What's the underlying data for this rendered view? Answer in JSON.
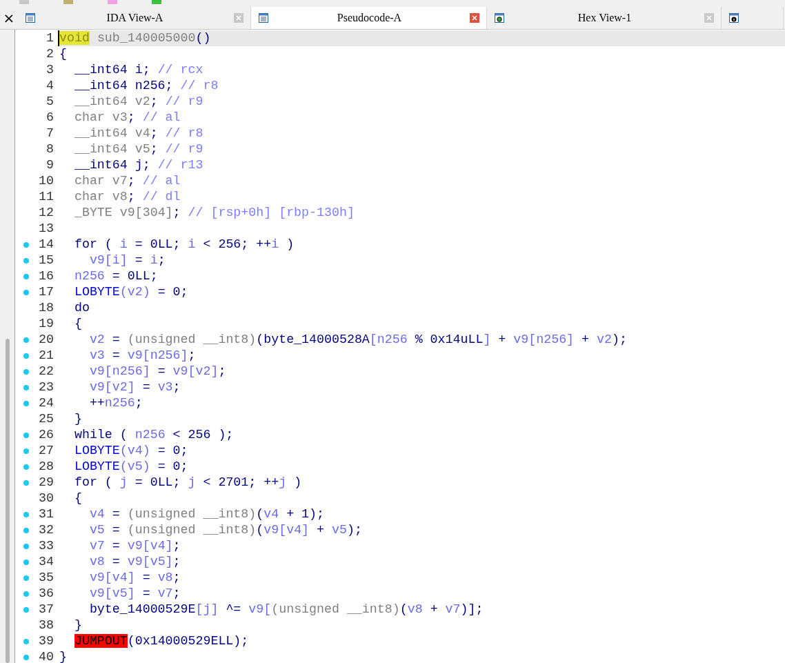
{
  "close_button": {
    "label": "×"
  },
  "tabs": [
    {
      "title": "IDA View-A",
      "kind": "listing",
      "selected": false
    },
    {
      "title": "Pseudocode-A",
      "kind": "listing",
      "selected": true
    },
    {
      "title": "Hex View-1",
      "kind": "hex",
      "selected": false
    },
    {
      "kind": "info",
      "selected": false
    }
  ],
  "code": {
    "lines": [
      {
        "number": "1",
        "breakpoint": false,
        "current": true,
        "tokens": [
          {
            "kind": "highlight",
            "text": "void"
          },
          {
            "kind": "dim",
            "text": " sub_140005000"
          },
          {
            "kind": "plain",
            "text": "()"
          }
        ]
      },
      {
        "number": "2",
        "breakpoint": false,
        "current": false,
        "tokens": [
          {
            "kind": "plain",
            "text": "{"
          }
        ]
      },
      {
        "number": "3",
        "breakpoint": false,
        "current": false,
        "tokens": [
          {
            "kind": "plain",
            "text": "  __int64 i; "
          },
          {
            "kind": "comment",
            "text": "// rcx"
          }
        ]
      },
      {
        "number": "4",
        "breakpoint": false,
        "current": false,
        "tokens": [
          {
            "kind": "plain",
            "text": "  __int64 n256; "
          },
          {
            "kind": "comment",
            "text": "// r8"
          }
        ]
      },
      {
        "number": "5",
        "breakpoint": false,
        "current": false,
        "tokens": [
          {
            "kind": "dim",
            "text": "  __int64 v2"
          },
          {
            "kind": "plain",
            "text": "; "
          },
          {
            "kind": "comment",
            "text": "// r9"
          }
        ]
      },
      {
        "number": "6",
        "breakpoint": false,
        "current": false,
        "tokens": [
          {
            "kind": "dim",
            "text": "  char v3"
          },
          {
            "kind": "plain",
            "text": "; "
          },
          {
            "kind": "comment",
            "text": "// al"
          }
        ]
      },
      {
        "number": "7",
        "breakpoint": false,
        "current": false,
        "tokens": [
          {
            "kind": "dim",
            "text": "  __int64 v4"
          },
          {
            "kind": "plain",
            "text": "; "
          },
          {
            "kind": "comment",
            "text": "// r8"
          }
        ]
      },
      {
        "number": "8",
        "breakpoint": false,
        "current": false,
        "tokens": [
          {
            "kind": "dim",
            "text": "  __int64 v5"
          },
          {
            "kind": "plain",
            "text": "; "
          },
          {
            "kind": "comment",
            "text": "// r9"
          }
        ]
      },
      {
        "number": "9",
        "breakpoint": false,
        "current": false,
        "tokens": [
          {
            "kind": "plain",
            "text": "  __int64 j; "
          },
          {
            "kind": "comment",
            "text": "// r13"
          }
        ]
      },
      {
        "number": "10",
        "breakpoint": false,
        "current": false,
        "tokens": [
          {
            "kind": "dim",
            "text": "  char v7"
          },
          {
            "kind": "plain",
            "text": "; "
          },
          {
            "kind": "comment",
            "text": "// al"
          }
        ]
      },
      {
        "number": "11",
        "breakpoint": false,
        "current": false,
        "tokens": [
          {
            "kind": "dim",
            "text": "  char v8"
          },
          {
            "kind": "plain",
            "text": "; "
          },
          {
            "kind": "comment",
            "text": "// dl"
          }
        ]
      },
      {
        "number": "12",
        "breakpoint": false,
        "current": false,
        "tokens": [
          {
            "kind": "dim",
            "text": "  _BYTE v9[304]"
          },
          {
            "kind": "plain",
            "text": "; "
          },
          {
            "kind": "comment",
            "text": "// [rsp+0h] [rbp-130h]"
          }
        ]
      },
      {
        "number": "13",
        "breakpoint": false,
        "current": false
      },
      {
        "number": "14",
        "breakpoint": true,
        "current": false,
        "tokens": [
          {
            "kind": "plain",
            "text": "  for ( "
          },
          {
            "kind": "var",
            "text": "i"
          },
          {
            "kind": "plain",
            "text": " = 0LL; "
          },
          {
            "kind": "var",
            "text": "i"
          },
          {
            "kind": "plain",
            "text": " < 256; ++"
          },
          {
            "kind": "var",
            "text": "i"
          },
          {
            "kind": "plain",
            "text": " )"
          }
        ]
      },
      {
        "number": "15",
        "breakpoint": true,
        "current": false,
        "tokens": [
          {
            "kind": "var",
            "text": "    v9[i]"
          },
          {
            "kind": "plain",
            "text": " = "
          },
          {
            "kind": "var",
            "text": "i"
          },
          {
            "kind": "plain",
            "text": ";"
          }
        ]
      },
      {
        "number": "16",
        "breakpoint": true,
        "current": false,
        "tokens": [
          {
            "kind": "var",
            "text": "  n256"
          },
          {
            "kind": "plain",
            "text": " = 0LL;"
          }
        ]
      },
      {
        "number": "17",
        "breakpoint": true,
        "current": false,
        "tokens": [
          {
            "kind": "func",
            "text": "  LOBYTE"
          },
          {
            "kind": "var",
            "text": "(v2)"
          },
          {
            "kind": "plain",
            "text": " = 0;"
          }
        ]
      },
      {
        "number": "18",
        "breakpoint": false,
        "current": false,
        "tokens": [
          {
            "kind": "plain",
            "text": "  do"
          }
        ]
      },
      {
        "number": "19",
        "breakpoint": false,
        "current": false,
        "tokens": [
          {
            "kind": "plain",
            "text": "  {"
          }
        ]
      },
      {
        "number": "20",
        "breakpoint": true,
        "current": false,
        "tokens": [
          {
            "kind": "var",
            "text": "    v2"
          },
          {
            "kind": "plain",
            "text": " = "
          },
          {
            "kind": "dim",
            "text": "(unsigned __int8)"
          },
          {
            "kind": "plain",
            "text": "(byte_14000528A"
          },
          {
            "kind": "var",
            "text": "[n256"
          },
          {
            "kind": "plain",
            "text": " % 0x14uLL"
          },
          {
            "kind": "var",
            "text": "]"
          },
          {
            "kind": "plain",
            "text": " + "
          },
          {
            "kind": "var",
            "text": "v9[n256]"
          },
          {
            "kind": "plain",
            "text": " + "
          },
          {
            "kind": "var",
            "text": "v2"
          },
          {
            "kind": "plain",
            "text": ");"
          }
        ]
      },
      {
        "number": "21",
        "breakpoint": true,
        "current": false,
        "tokens": [
          {
            "kind": "var",
            "text": "    v3"
          },
          {
            "kind": "plain",
            "text": " = "
          },
          {
            "kind": "var",
            "text": "v9[n256]"
          },
          {
            "kind": "plain",
            "text": ";"
          }
        ]
      },
      {
        "number": "22",
        "breakpoint": true,
        "current": false,
        "tokens": [
          {
            "kind": "var",
            "text": "    v9[n256]"
          },
          {
            "kind": "plain",
            "text": " = "
          },
          {
            "kind": "var",
            "text": "v9[v2]"
          },
          {
            "kind": "plain",
            "text": ";"
          }
        ]
      },
      {
        "number": "23",
        "breakpoint": true,
        "current": false,
        "tokens": [
          {
            "kind": "var",
            "text": "    v9[v2]"
          },
          {
            "kind": "plain",
            "text": " = "
          },
          {
            "kind": "var",
            "text": "v3"
          },
          {
            "kind": "plain",
            "text": ";"
          }
        ]
      },
      {
        "number": "24",
        "breakpoint": true,
        "current": false,
        "tokens": [
          {
            "kind": "plain",
            "text": "    ++"
          },
          {
            "kind": "var",
            "text": "n256"
          },
          {
            "kind": "plain",
            "text": ";"
          }
        ]
      },
      {
        "number": "25",
        "breakpoint": false,
        "current": false,
        "tokens": [
          {
            "kind": "plain",
            "text": "  }"
          }
        ]
      },
      {
        "number": "26",
        "breakpoint": true,
        "current": false,
        "tokens": [
          {
            "kind": "plain",
            "text": "  while ( "
          },
          {
            "kind": "var",
            "text": "n256"
          },
          {
            "kind": "plain",
            "text": " < 256 );"
          }
        ]
      },
      {
        "number": "27",
        "breakpoint": true,
        "current": false,
        "tokens": [
          {
            "kind": "func",
            "text": "  LOBYTE"
          },
          {
            "kind": "var",
            "text": "(v4)"
          },
          {
            "kind": "plain",
            "text": " = 0;"
          }
        ]
      },
      {
        "number": "28",
        "breakpoint": true,
        "current": false,
        "tokens": [
          {
            "kind": "func",
            "text": "  LOBYTE"
          },
          {
            "kind": "var",
            "text": "(v5)"
          },
          {
            "kind": "plain",
            "text": " = 0;"
          }
        ]
      },
      {
        "number": "29",
        "breakpoint": true,
        "current": false,
        "tokens": [
          {
            "kind": "plain",
            "text": "  for ( "
          },
          {
            "kind": "var",
            "text": "j"
          },
          {
            "kind": "plain",
            "text": " = 0LL; "
          },
          {
            "kind": "var",
            "text": "j"
          },
          {
            "kind": "plain",
            "text": " < 2701; ++"
          },
          {
            "kind": "var",
            "text": "j"
          },
          {
            "kind": "plain",
            "text": " )"
          }
        ]
      },
      {
        "number": "30",
        "breakpoint": false,
        "current": false,
        "tokens": [
          {
            "kind": "plain",
            "text": "  {"
          }
        ]
      },
      {
        "number": "31",
        "breakpoint": true,
        "current": false,
        "tokens": [
          {
            "kind": "var",
            "text": "    v4"
          },
          {
            "kind": "plain",
            "text": " = "
          },
          {
            "kind": "dim",
            "text": "(unsigned __int8)"
          },
          {
            "kind": "plain",
            "text": "("
          },
          {
            "kind": "var",
            "text": "v4"
          },
          {
            "kind": "plain",
            "text": " + 1);"
          }
        ]
      },
      {
        "number": "32",
        "breakpoint": true,
        "current": false,
        "tokens": [
          {
            "kind": "var",
            "text": "    v5"
          },
          {
            "kind": "plain",
            "text": " = "
          },
          {
            "kind": "dim",
            "text": "(unsigned __int8)"
          },
          {
            "kind": "plain",
            "text": "("
          },
          {
            "kind": "var",
            "text": "v9[v4]"
          },
          {
            "kind": "plain",
            "text": " + "
          },
          {
            "kind": "var",
            "text": "v5"
          },
          {
            "kind": "plain",
            "text": ");"
          }
        ]
      },
      {
        "number": "33",
        "breakpoint": true,
        "current": false,
        "tokens": [
          {
            "kind": "var",
            "text": "    v7"
          },
          {
            "kind": "plain",
            "text": " = "
          },
          {
            "kind": "var",
            "text": "v9[v4]"
          },
          {
            "kind": "plain",
            "text": ";"
          }
        ]
      },
      {
        "number": "34",
        "breakpoint": true,
        "current": false,
        "tokens": [
          {
            "kind": "var",
            "text": "    v8"
          },
          {
            "kind": "plain",
            "text": " = "
          },
          {
            "kind": "var",
            "text": "v9[v5]"
          },
          {
            "kind": "plain",
            "text": ";"
          }
        ]
      },
      {
        "number": "35",
        "breakpoint": true,
        "current": false,
        "tokens": [
          {
            "kind": "var",
            "text": "    v9[v4]"
          },
          {
            "kind": "plain",
            "text": " = "
          },
          {
            "kind": "var",
            "text": "v8"
          },
          {
            "kind": "plain",
            "text": ";"
          }
        ]
      },
      {
        "number": "36",
        "breakpoint": true,
        "current": false,
        "tokens": [
          {
            "kind": "var",
            "text": "    v9[v5]"
          },
          {
            "kind": "plain",
            "text": " = "
          },
          {
            "kind": "var",
            "text": "v7"
          },
          {
            "kind": "plain",
            "text": ";"
          }
        ]
      },
      {
        "number": "37",
        "breakpoint": true,
        "current": false,
        "tokens": [
          {
            "kind": "plain",
            "text": "    byte_14000529E"
          },
          {
            "kind": "var",
            "text": "[j]"
          },
          {
            "kind": "plain",
            "text": " ^= "
          },
          {
            "kind": "var",
            "text": "v9["
          },
          {
            "kind": "dim",
            "text": "(unsigned __int8)"
          },
          {
            "kind": "plain",
            "text": "("
          },
          {
            "kind": "var",
            "text": "v8"
          },
          {
            "kind": "plain",
            "text": " + "
          },
          {
            "kind": "var",
            "text": "v7"
          },
          {
            "kind": "plain",
            "text": ")];"
          }
        ]
      },
      {
        "number": "38",
        "breakpoint": false,
        "current": false,
        "tokens": [
          {
            "kind": "plain",
            "text": "  }"
          }
        ]
      },
      {
        "number": "39",
        "breakpoint": true,
        "current": false,
        "tokens": [
          {
            "kind": "error",
            "text": "  JUMPOUT"
          },
          {
            "kind": "plain",
            "text": "(0x14000529ELL);"
          }
        ]
      },
      {
        "number": "40",
        "breakpoint": true,
        "current": false,
        "tokens": [
          {
            "kind": "plain",
            "text": "}"
          }
        ]
      }
    ]
  }
}
